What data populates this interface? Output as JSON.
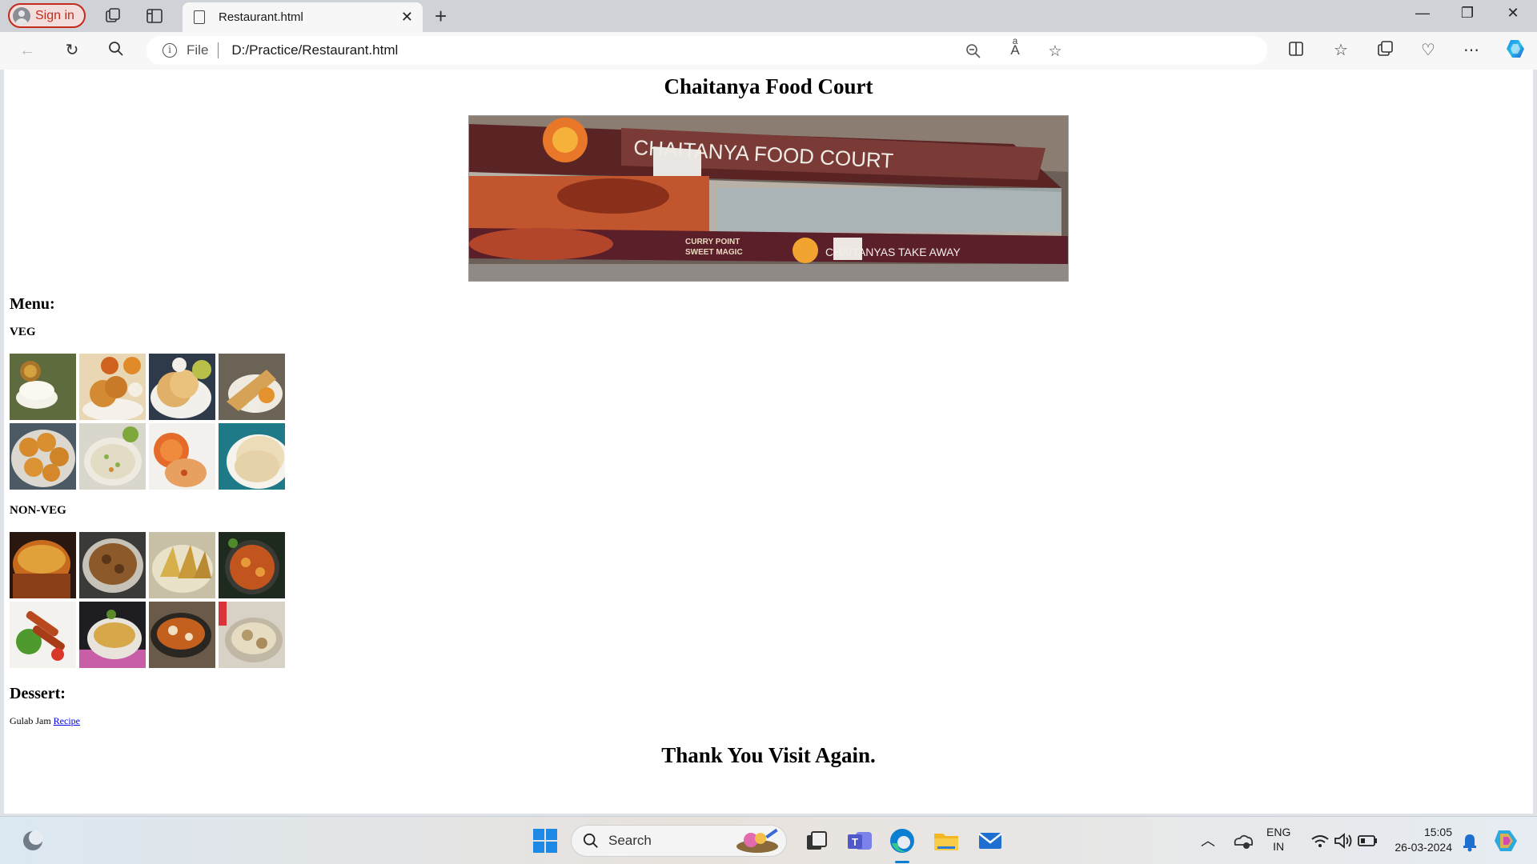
{
  "browser": {
    "signin_label": "Sign in",
    "tab_title": "Restaurant.html",
    "url_protocol": "File",
    "url": "D:/Practice/Restaurant.html"
  },
  "page": {
    "heading": "Chaitanya Food Court",
    "banner_sign": "CHAITANYA FOOD COURT",
    "banner_sign_lower": "CHAITANYAS TAKE AWAY",
    "banner_curry": "CURRY POINT",
    "banner_sweet": "SWEET MAGIC",
    "menu_heading": "Menu:",
    "veg_heading": "VEG",
    "nonveg_heading": "NON-VEG",
    "dessert_heading": "Dessert:",
    "dessert_item": "Gulab Jam",
    "dessert_link": "Recipe",
    "footer": "Thank You Visit Again."
  },
  "taskbar": {
    "search_label": "Search",
    "lang_top": "ENG",
    "lang_bottom": "IN",
    "time": "15:05",
    "date": "26-03-2024"
  }
}
